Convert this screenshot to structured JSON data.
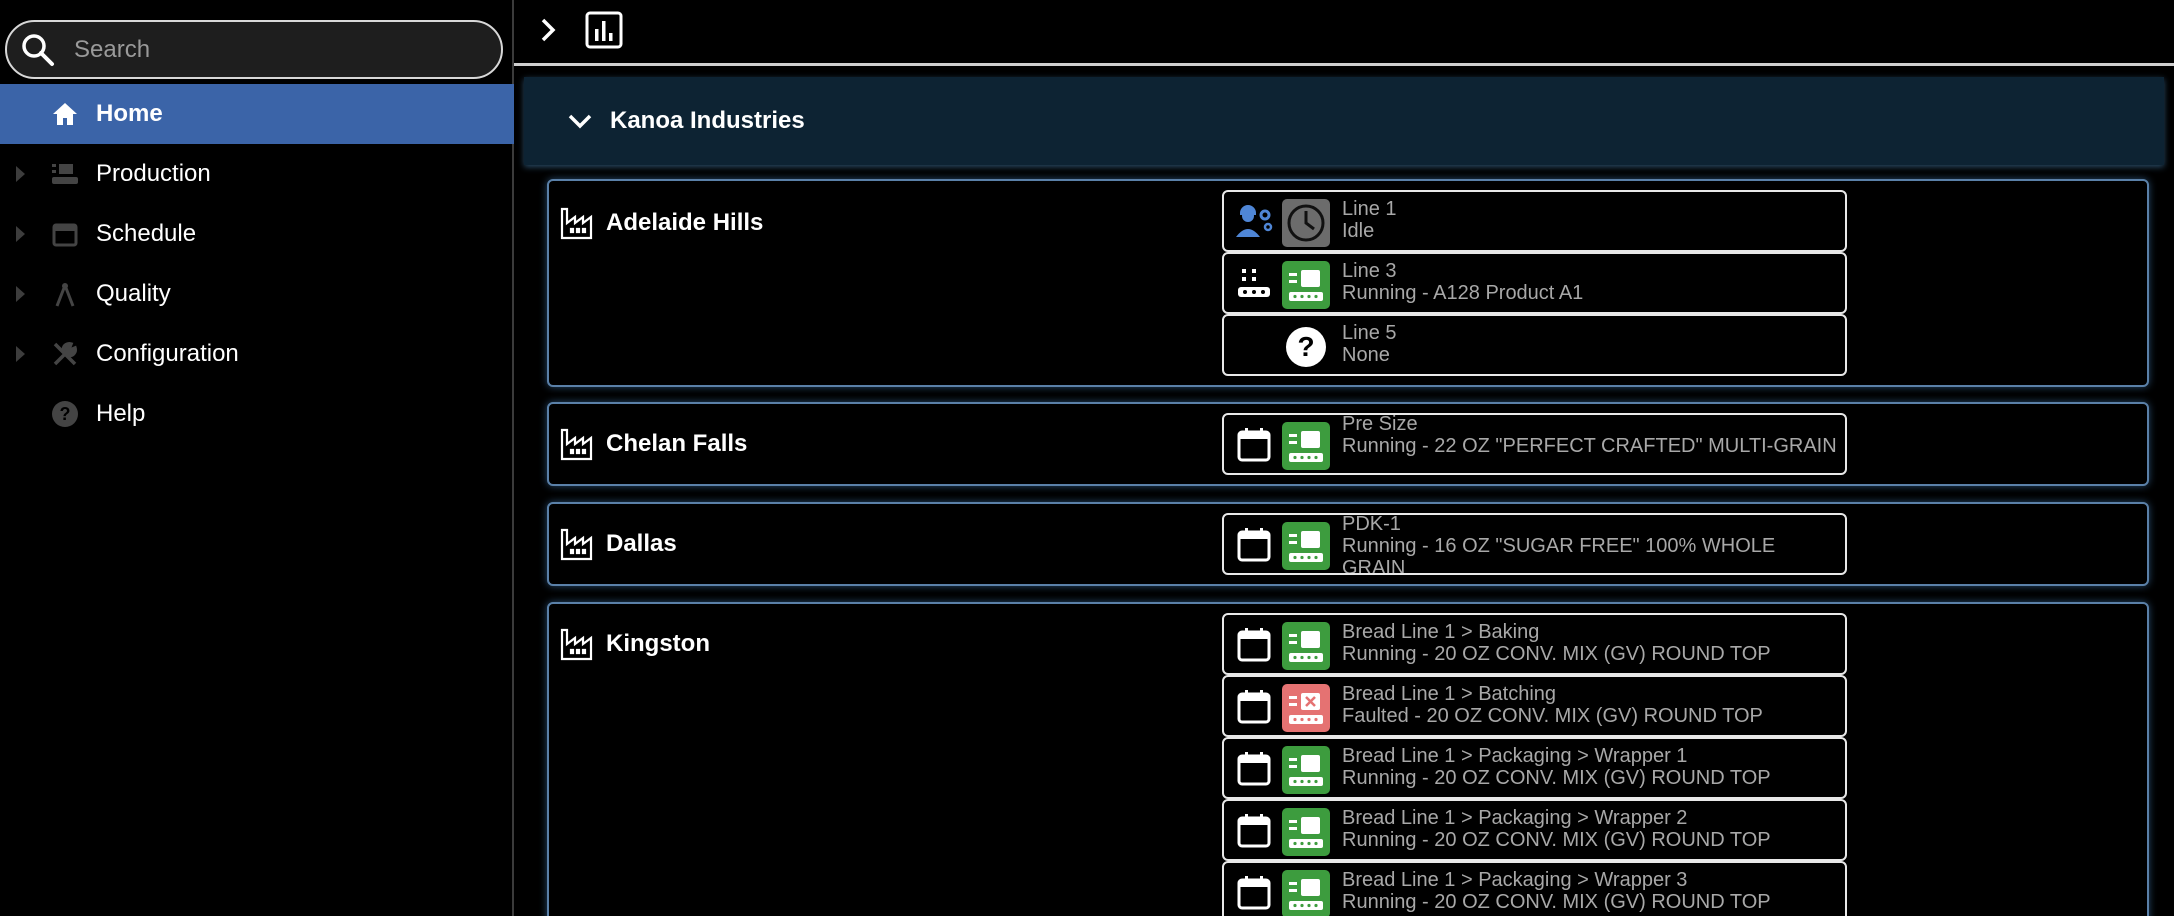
{
  "search": {
    "placeholder": "Search"
  },
  "sidebar": {
    "items": [
      {
        "label": "Home",
        "icon": "home-icon",
        "active": true
      },
      {
        "label": "Production",
        "icon": "production-icon"
      },
      {
        "label": "Schedule",
        "icon": "calendar-icon"
      },
      {
        "label": "Quality",
        "icon": "compass-icon"
      },
      {
        "label": "Configuration",
        "icon": "tools-icon"
      },
      {
        "label": "Help",
        "icon": "help-icon"
      }
    ]
  },
  "org": {
    "name": "Kanoa Industries"
  },
  "sites": [
    {
      "name": "Adelaide Hills",
      "lines": [
        {
          "name": "Line 1",
          "status": "Idle",
          "state": "idle"
        },
        {
          "name": "Line 3",
          "status": "Running - A128 Product A1",
          "state": "running"
        },
        {
          "name": "Line 5",
          "status": "None",
          "state": "none"
        }
      ]
    },
    {
      "name": "Chelan Falls",
      "lines": [
        {
          "name": "Pre Size",
          "status": "Running - 22 OZ \"PERFECT CRAFTED\" MULTI-GRAIN",
          "state": "running"
        }
      ]
    },
    {
      "name": "Dallas",
      "lines": [
        {
          "name": "PDK-1",
          "status": "Running - 16 OZ \"SUGAR FREE\" 100% WHOLE GRAIN",
          "state": "running"
        }
      ]
    },
    {
      "name": "Kingston",
      "lines": [
        {
          "name": "Bread Line 1 > Baking",
          "status": "Running - 20 OZ CONV. MIX (GV) ROUND TOP",
          "state": "running"
        },
        {
          "name": "Bread Line 1 > Batching",
          "status": "Faulted - 20 OZ CONV. MIX (GV) ROUND TOP",
          "state": "faulted"
        },
        {
          "name": "Bread Line 1 > Packaging > Wrapper 1",
          "status": "Running - 20 OZ CONV. MIX (GV) ROUND TOP",
          "state": "running"
        },
        {
          "name": "Bread Line 1 > Packaging > Wrapper 2",
          "status": "Running - 20 OZ CONV. MIX (GV) ROUND TOP",
          "state": "running"
        },
        {
          "name": "Bread Line 1 > Packaging > Wrapper 3",
          "status": "Running - 20 OZ CONV. MIX (GV) ROUND TOP",
          "state": "running"
        }
      ]
    }
  ],
  "colors": {
    "accent": "#3b64a8",
    "running": "#3d9c3e",
    "faulted": "#e57272",
    "idle": "#6c6c6c",
    "site_border": "#5a80a8",
    "header_bg": "#0d2333"
  }
}
